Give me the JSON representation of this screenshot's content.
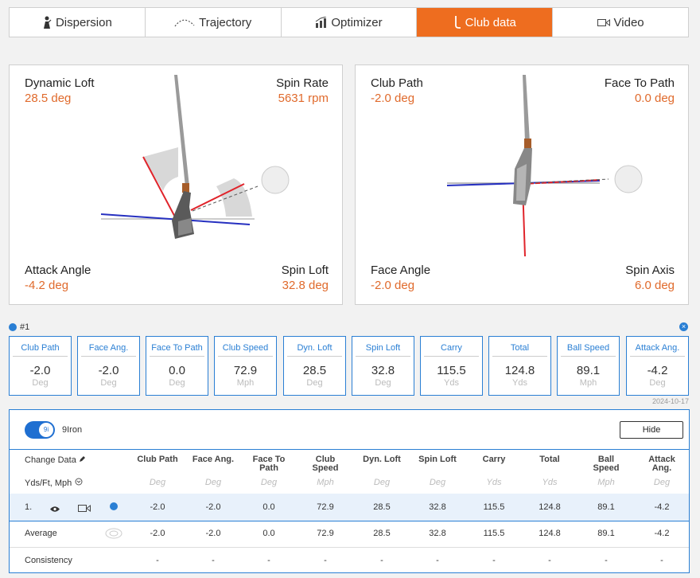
{
  "tabs": [
    {
      "label": "Dispersion",
      "icon": "golfer-icon",
      "active": false
    },
    {
      "label": "Trajectory",
      "icon": "trajectory-icon",
      "active": false
    },
    {
      "label": "Optimizer",
      "icon": "optimizer-icon",
      "active": false
    },
    {
      "label": "Club data",
      "icon": "club-icon",
      "active": true
    },
    {
      "label": "Video",
      "icon": "video-icon",
      "active": false
    }
  ],
  "side_panel": {
    "dynamic_loft_label": "Dynamic Loft",
    "dynamic_loft_value": "28.5 deg",
    "spin_rate_label": "Spin Rate",
    "spin_rate_value": "5631 rpm",
    "attack_angle_label": "Attack Angle",
    "attack_angle_value": "-4.2 deg",
    "spin_loft_label": "Spin Loft",
    "spin_loft_value": "32.8 deg"
  },
  "front_panel": {
    "club_path_label": "Club Path",
    "club_path_value": "-2.0 deg",
    "face_to_path_label": "Face To Path",
    "face_to_path_value": "0.0 deg",
    "face_angle_label": "Face Angle",
    "face_angle_value": "-2.0 deg",
    "spin_axis_label": "Spin Axis",
    "spin_axis_value": "6.0 deg"
  },
  "shot_number": "#1",
  "cards": [
    {
      "title": "Club Path",
      "value": "-2.0",
      "unit": "Deg"
    },
    {
      "title": "Face Ang.",
      "value": "-2.0",
      "unit": "Deg"
    },
    {
      "title": "Face To Path",
      "value": "0.0",
      "unit": "Deg"
    },
    {
      "title": "Club Speed",
      "value": "72.9",
      "unit": "Mph"
    },
    {
      "title": "Dyn. Loft",
      "value": "28.5",
      "unit": "Deg"
    },
    {
      "title": "Spin Loft",
      "value": "32.8",
      "unit": "Deg"
    },
    {
      "title": "Carry",
      "value": "115.5",
      "unit": "Yds"
    },
    {
      "title": "Total",
      "value": "124.8",
      "unit": "Yds"
    },
    {
      "title": "Ball Speed",
      "value": "89.1",
      "unit": "Mph"
    },
    {
      "title": "Attack Ang.",
      "value": "-4.2",
      "unit": "Deg"
    }
  ],
  "date": "2024-10-17",
  "table": {
    "toggle_badge": "9i",
    "club_name": "9Iron",
    "hide_label": "Hide",
    "change_data_label": "Change Data",
    "units_label": "Yds/Ft, Mph",
    "columns": [
      {
        "lines": [
          "Club Path"
        ],
        "unit": "Deg"
      },
      {
        "lines": [
          "Face Ang."
        ],
        "unit": "Deg"
      },
      {
        "lines": [
          "Face To",
          "Path"
        ],
        "unit": "Deg"
      },
      {
        "lines": [
          "Club",
          "Speed"
        ],
        "unit": "Mph"
      },
      {
        "lines": [
          "Dyn. Loft"
        ],
        "unit": "Deg"
      },
      {
        "lines": [
          "Spin Loft"
        ],
        "unit": "Deg"
      },
      {
        "lines": [
          "Carry"
        ],
        "unit": "Yds"
      },
      {
        "lines": [
          "Total"
        ],
        "unit": "Yds"
      },
      {
        "lines": [
          "Ball",
          "Speed"
        ],
        "unit": "Mph"
      },
      {
        "lines": [
          "Attack",
          "Ang."
        ],
        "unit": "Deg"
      }
    ],
    "rows": [
      {
        "label": "1.",
        "values": [
          "-2.0",
          "-2.0",
          "0.0",
          "72.9",
          "28.5",
          "32.8",
          "115.5",
          "124.8",
          "89.1",
          "-4.2"
        ]
      },
      {
        "label": "Average",
        "values": [
          "-2.0",
          "-2.0",
          "0.0",
          "72.9",
          "28.5",
          "32.8",
          "115.5",
          "124.8",
          "89.1",
          "-4.2"
        ]
      },
      {
        "label": "Consistency",
        "values": [
          "-",
          "-",
          "-",
          "-",
          "-",
          "-",
          "-",
          "-",
          "-",
          "-"
        ]
      }
    ]
  },
  "colors": {
    "accent": "#ee6d1f",
    "value": "#e06a2c",
    "blue": "#2a7fd4"
  }
}
